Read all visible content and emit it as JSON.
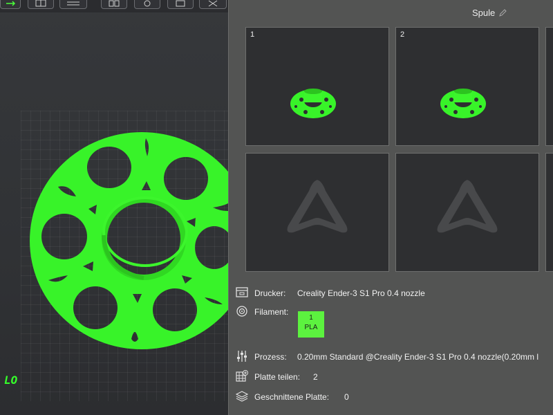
{
  "viewport": {
    "corner_label": "LO",
    "model_color": "#38f329",
    "toolbar_icons": [
      "move-icon",
      "layout-icon",
      "arrange-icon",
      "split-icon",
      "rotate-icon",
      "scale-icon",
      "cut-icon"
    ]
  },
  "dialog": {
    "title": "Spule",
    "plates": [
      {
        "number": "1",
        "has_model": true
      },
      {
        "number": "2",
        "has_model": true
      },
      {
        "number": "",
        "has_model": false
      },
      {
        "number": "",
        "has_model": false
      }
    ],
    "info": {
      "printer_label": "Drucker:",
      "printer_value": "Creality Ender-3 S1 Pro 0.4 nozzle",
      "filament_label": "Filament:",
      "filament_slot": "1",
      "filament_material": "PLA",
      "filament_color": "#5cf23f",
      "process_label": "Prozess:",
      "process_value": "0.20mm Standard @Creality Ender-3 S1 Pro 0.4 nozzle(0.20mm l",
      "split_plate_label": "Platte teilen:",
      "split_plate_value": "2",
      "sliced_plate_label": "Geschnittene Platte:",
      "sliced_plate_value": "0"
    }
  }
}
